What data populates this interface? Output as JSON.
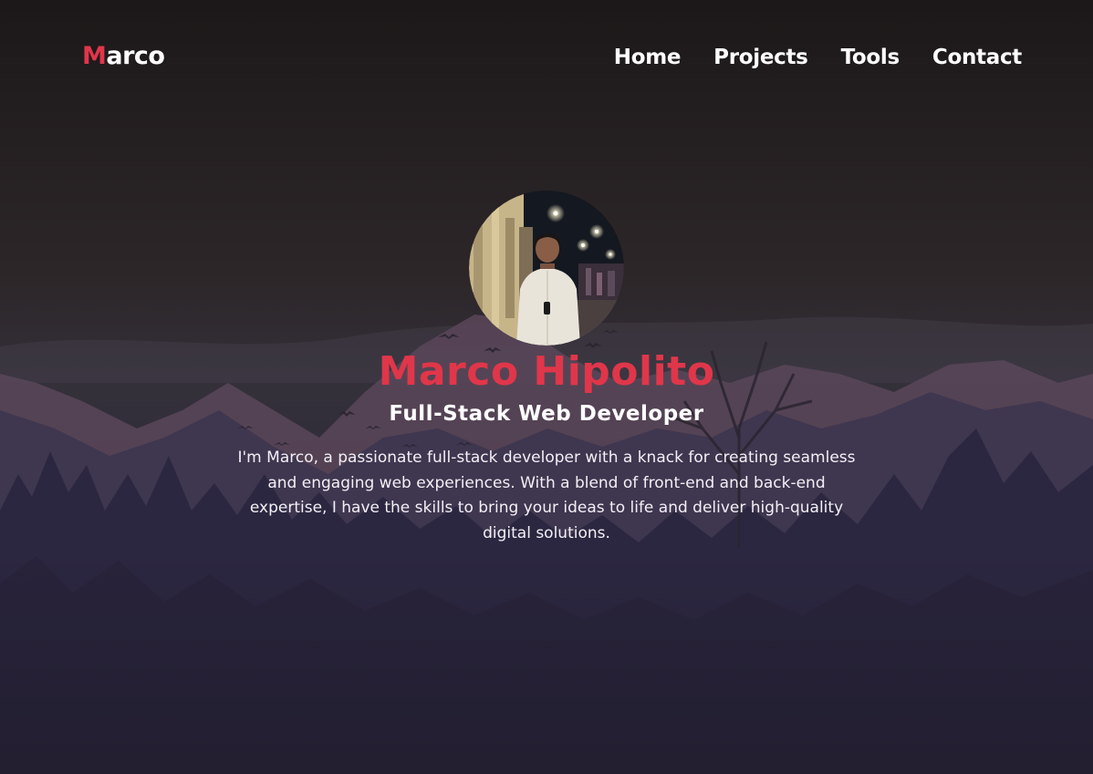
{
  "header": {
    "logo_first_letter": "M",
    "logo_rest": "arco",
    "nav": [
      {
        "label": "Home"
      },
      {
        "label": "Projects"
      },
      {
        "label": "Tools"
      },
      {
        "label": "Contact"
      }
    ]
  },
  "hero": {
    "name": "Marco Hipolito",
    "role": "Full-Stack Web Developer",
    "bio": "I'm Marco, a passionate full-stack developer with a knack for creating seamless and engaging web experiences. With a blend of front-end and back-end expertise, I have the skills to bring your ideas to life and deliver high-quality digital solutions."
  },
  "colors": {
    "accent": "#e0364a",
    "text": "#ffffff",
    "background_top": "#1c1819",
    "background_bottom": "#241f33"
  }
}
